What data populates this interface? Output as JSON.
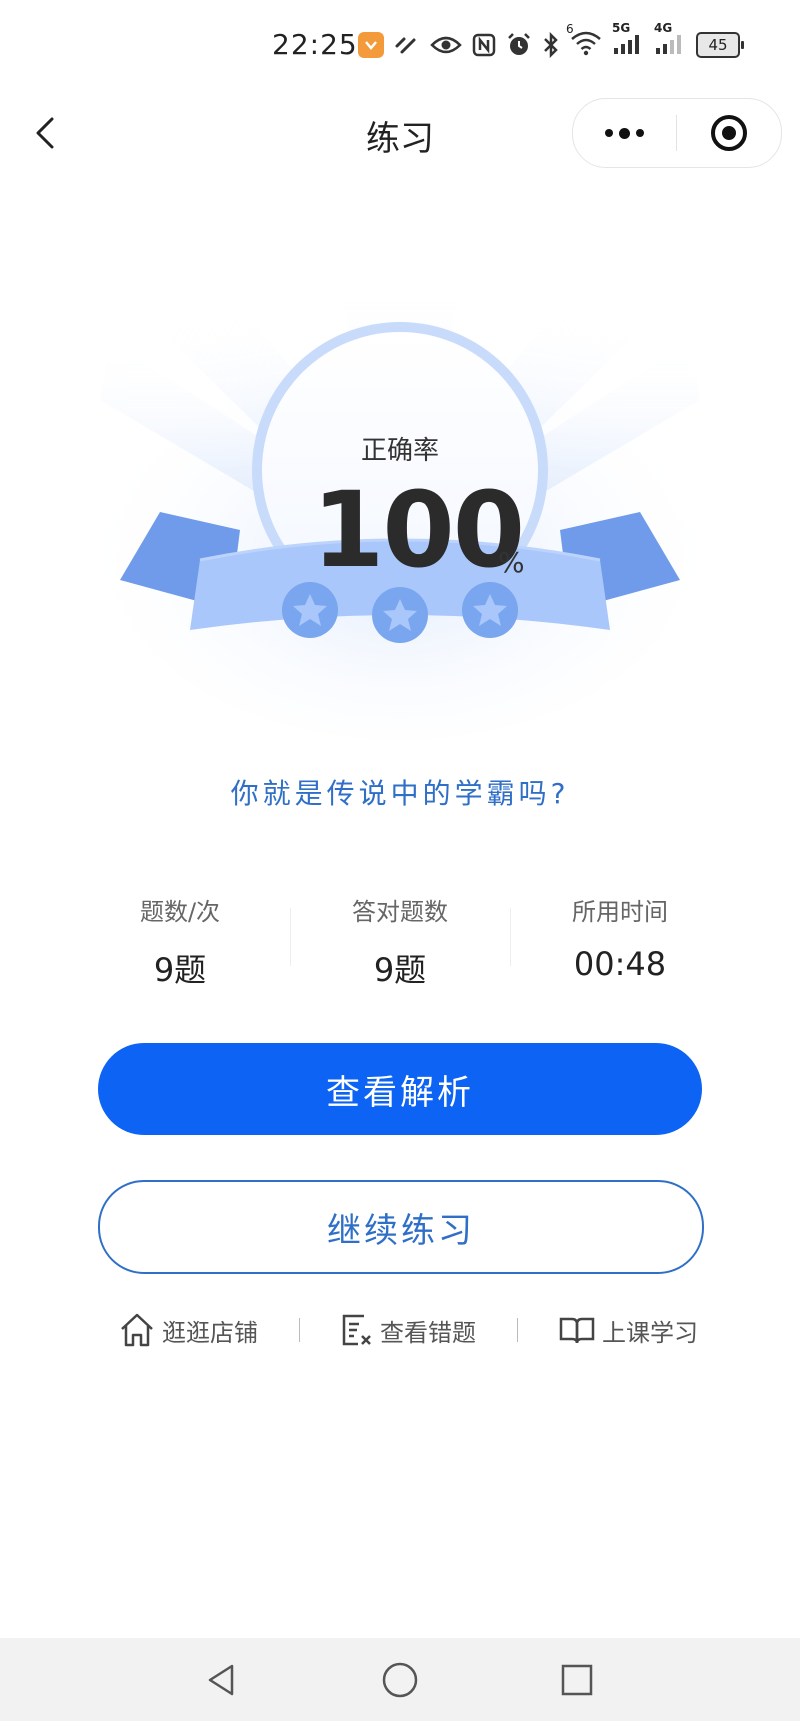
{
  "status_bar": {
    "time": "22:25",
    "battery": "45",
    "network_1": "5G",
    "network_2": "4G",
    "wifi_badge": "6"
  },
  "nav": {
    "title": "练习"
  },
  "result": {
    "accuracy_label": "正确率",
    "accuracy_value": "100",
    "accuracy_unit": "%",
    "accuracy_fraction": 1.0,
    "stars": 3,
    "slogan": "你就是传说中的学霸吗?"
  },
  "stats": [
    {
      "label": "题数/次",
      "value": "9题"
    },
    {
      "label": "答对题数",
      "value": "9题"
    },
    {
      "label": "所用时间",
      "value": "00:48"
    }
  ],
  "buttons": {
    "view_analysis": "查看解析",
    "continue_practice": "继续练习"
  },
  "links": {
    "shop": "逛逛店铺",
    "wrong_questions": "查看错题",
    "study": "上课学习"
  },
  "colors": {
    "primary": "#0d63f3",
    "accent_text": "#2f6fc7",
    "ribbon": "#8fb4f5",
    "ribbon_light": "#a9c7fb",
    "star_circle": "#7aa6ef"
  }
}
